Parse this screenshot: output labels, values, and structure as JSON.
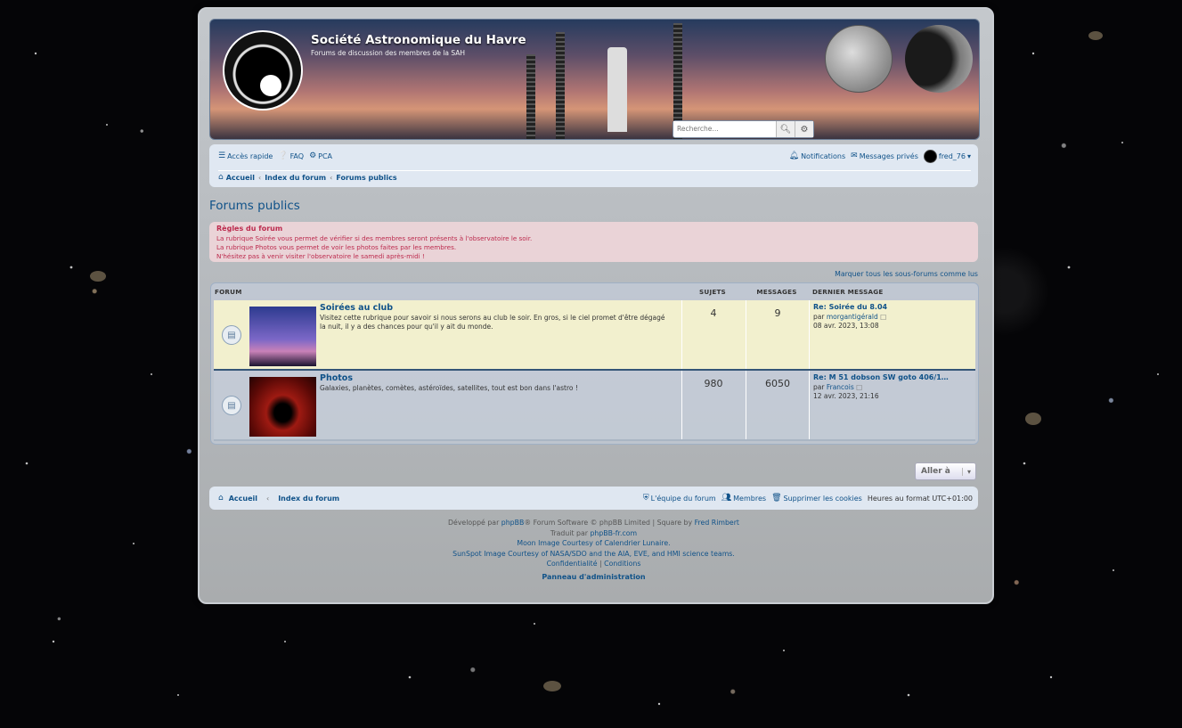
{
  "site": {
    "title": "Société Astronomique du Havre",
    "description": "Forums de discussion des membres de la SAH"
  },
  "search": {
    "placeholder": "Recherche…"
  },
  "navbar": {
    "quick_access": "Accès rapide",
    "faq": "FAQ",
    "ucp": "PCA",
    "notifications": "Notifications",
    "private_messages": "Messages privés",
    "username": "fred_76"
  },
  "breadcrumb": [
    "Accueil",
    "Index du forum",
    "Forums publics"
  ],
  "page_title": "Forums publics",
  "rules": {
    "title": "Règles du forum",
    "lines": [
      "La rubrique Soirée vous permet de vérifier si des membres seront présents à l'observatoire le soir.",
      "La rubrique Photos vous permet de voir les photos faites par les membres.",
      "N'hésitez pas à venir visiter l'observatoire le samedi après-midi !"
    ]
  },
  "mark_read": "Marquer tous les sous-forums comme lus",
  "table_headers": {
    "forum": "Forum",
    "topics": "Sujets",
    "posts": "Messages",
    "last_post": "Dernier message"
  },
  "forums": [
    {
      "name": "Soirées au club",
      "description": "Visitez cette rubrique pour savoir si nous serons au club le soir. En gros, si le ciel promet d'être dégagé la nuit, il y a des chances pour qu'il y ait du monde.",
      "topics": "4",
      "posts": "9",
      "last_title": "Re: Soirée du 8.04",
      "last_by_prefix": "par",
      "last_author": "morgantigérald",
      "last_date": "08 avr. 2023, 13:08"
    },
    {
      "name": "Photos",
      "description": "Galaxies, planètes, comètes, astéroïdes, satellites, tout est bon dans l'astro !",
      "topics": "980",
      "posts": "6050",
      "last_title": "Re: M 51 dobson SW goto 406/1…",
      "last_by_prefix": "par",
      "last_author": "Francois",
      "last_date": "12 avr. 2023, 21:16"
    }
  ],
  "jump_to": "Aller à",
  "footer": {
    "home": "Accueil",
    "index": "Index du forum",
    "team": "L'équipe du forum",
    "members": "Membres",
    "delete_cookies": "Supprimer les cookies",
    "timezone_label": "Heures au format",
    "timezone_value": "UTC+01:00"
  },
  "copyright": {
    "powered_prefix": "Développé par",
    "phpbb": "phpBB",
    "powered_suffix": "® Forum Software © phpBB Limited",
    "style_sep": "|",
    "style_prefix": "Square by",
    "style_author": "Fred Rimbert",
    "translated_prefix": "Traduit par",
    "translated_by": "phpBB-fr.com",
    "moon_credit": "Moon Image Courtesy of Calendrier Lunaire.",
    "sun_credit": "SunSpot Image Courtesy of NASA/SDO and the AIA, EVE, and HMI science teams.",
    "privacy": "Confidentialité",
    "terms": "Conditions"
  },
  "admin_panel": "Panneau d'administration",
  "colors": {
    "link": "#105289",
    "rules_text": "#bc2a4d",
    "row_highlight": "#f4f2ce"
  }
}
